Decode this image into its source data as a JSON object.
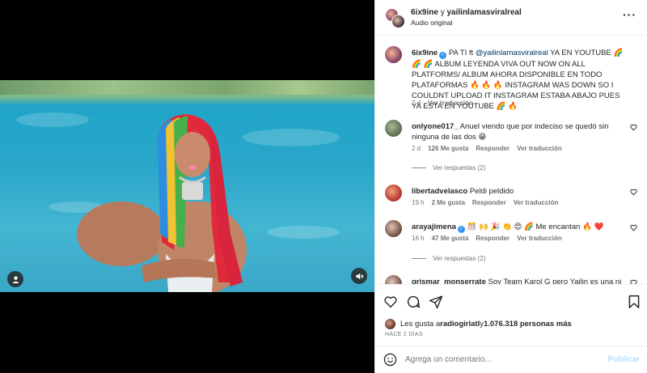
{
  "media": {
    "user_icon": "user-icon",
    "mute_icon": "muted-speaker-icon"
  },
  "header": {
    "author": "6ix9ine",
    "connector": " y ",
    "collaborator": "yailinlamasviralreal",
    "audio": "Audio original",
    "more_icon": "more-options-icon"
  },
  "caption": {
    "username": "6ix9ine",
    "text_pre": " PA TI ft ",
    "mention": "@yailinlamasviralreal",
    "text_post": " YA EN YOUTUBE 🌈 🌈 🌈 ALBUM LEYENDA VIVA OUT NOW ON ALL PLATFORMS/ ALBUM AHORA DISPONIBLE EN TODO PLATAFORMAS 🔥 🔥 🔥 INSTAGRAM WAS DOWN SO I COULDNT UPLOAD IT INSTAGRAM ESTABA ABAJO PUES YA ESTA EN YOUTUBE 🌈 🔥",
    "time": "2 d",
    "translate": "Ver traducción"
  },
  "comments": [
    {
      "username": "onlyone017_",
      "text": " Anuel viendo que por indeciso se quedó sin ninguna de las dos 😁",
      "time": "2 d",
      "likes": "126 Me gusta",
      "reply": "Responder",
      "translate": "Ver traducción",
      "replies": "Ver respuestas (2)"
    },
    {
      "username": "libertadvelasco",
      "text": " Peldi peldido",
      "time": "19 h",
      "likes": "2 Me gusta",
      "reply": "Responder",
      "translate": "Ver traducción"
    },
    {
      "username": "arayajimena",
      "text": " 🎊 🙌 🎉 👏 😍 🌈 Me encantan 🔥 ❤️",
      "time": "16 h",
      "likes": "47 Me gusta",
      "reply": "Responder",
      "translate": "Ver traducción",
      "replies": "Ver respuestas (2)"
    },
    {
      "username": "grismar_monserrate",
      "text": " Soy Team Karol G pero Yailin es una niña"
    }
  ],
  "actions": {
    "like_icon": "heart-icon",
    "comment_icon": "comment-icon",
    "share_icon": "share-icon",
    "save_icon": "bookmark-icon"
  },
  "likes": {
    "prefix": "Les gusta a ",
    "user": "radiogirlatl",
    "middle": " y ",
    "count": "1.076.318 personas más"
  },
  "posted_ago": "HACE 2 DÍAS",
  "composer": {
    "placeholder": "Agrega un comentario...",
    "post": "Publicar",
    "emoji_icon": "emoji-icon"
  }
}
